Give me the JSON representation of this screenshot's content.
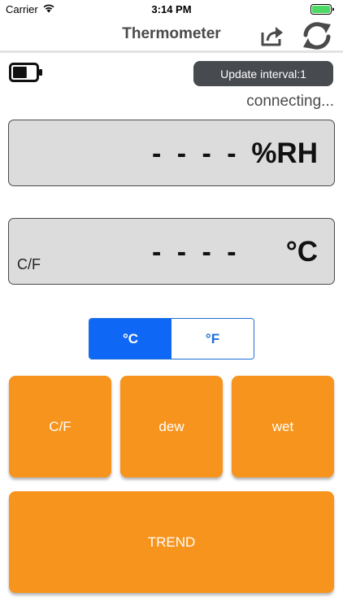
{
  "status_bar": {
    "carrier": "Carrier",
    "time": "3:14 PM",
    "wifi_icon": "wifi-icon",
    "battery_icon": "battery-full-icon",
    "battery_color": "#4cd964"
  },
  "nav": {
    "title": "Thermometer",
    "share_icon": "share-icon",
    "refresh_icon": "refresh-icon"
  },
  "device": {
    "battery_icon": "battery-low-icon",
    "battery_level": 0.6,
    "update_interval_label": "Update interval:1",
    "connection_status": "connecting..."
  },
  "readings": {
    "humidity": {
      "value": "- - - -",
      "unit": "%RH"
    },
    "temperature": {
      "value": "- - - -",
      "unit": "°C",
      "mode_label": "C/F"
    }
  },
  "unit_toggle": {
    "options": [
      {
        "label": "°C",
        "selected": true
      },
      {
        "label": "°F",
        "selected": false
      }
    ],
    "selected_color": "#0e68f5"
  },
  "buttons": {
    "cf_label": "C/F",
    "dew_label": "dew",
    "wet_label": "wet",
    "trend_label": "TREND",
    "color": "#f7941d"
  }
}
